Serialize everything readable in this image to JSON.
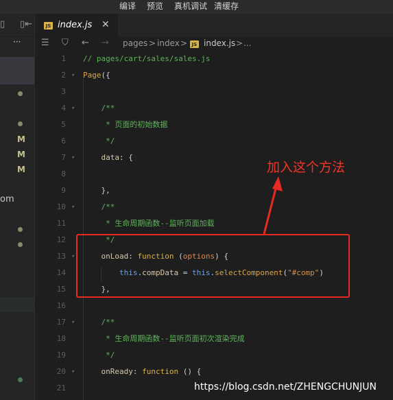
{
  "topbar": {
    "menu": [
      "编译",
      "预览",
      "真机调试",
      "清缓存"
    ]
  },
  "sidebar": {
    "partial_text": "om",
    "git_marks": [
      "M",
      "M",
      "M"
    ],
    "header_icons": [
      "collapse-icon",
      "more-icon"
    ],
    "more_glyph": "···"
  },
  "tab": {
    "label": "index.js",
    "badge": "JS",
    "close_glyph": "✕"
  },
  "breadcrumb": {
    "items": [
      "pages",
      "index",
      "index.js",
      "..."
    ],
    "separator": ">"
  },
  "editor": {
    "lines": [
      {
        "n": "1",
        "fold": "",
        "tokens": [
          [
            "c-comment",
            "// pages/cart/sales/sales.js"
          ]
        ]
      },
      {
        "n": "2",
        "fold": "▾",
        "tokens": [
          [
            "c-func",
            "Page"
          ],
          [
            "c-punct",
            "({"
          ]
        ]
      },
      {
        "n": "3",
        "fold": "",
        "tokens": []
      },
      {
        "n": "4",
        "fold": "▾",
        "tokens": [
          [
            "c-comment",
            "    /**"
          ]
        ]
      },
      {
        "n": "5",
        "fold": "",
        "tokens": [
          [
            "c-comment",
            "     * 页面的初始数据"
          ]
        ]
      },
      {
        "n": "6",
        "fold": "",
        "tokens": [
          [
            "c-comment",
            "     */"
          ]
        ]
      },
      {
        "n": "7",
        "fold": "▾",
        "tokens": [
          [
            "c-ident",
            "    data"
          ],
          [
            "c-punct",
            ": {"
          ]
        ]
      },
      {
        "n": "8",
        "fold": "",
        "tokens": []
      },
      {
        "n": "9",
        "fold": "",
        "tokens": [
          [
            "c-punct",
            "    },"
          ]
        ]
      },
      {
        "n": "10",
        "fold": "▾",
        "tokens": [
          [
            "c-comment",
            "    /**"
          ]
        ]
      },
      {
        "n": "11",
        "fold": "",
        "tokens": [
          [
            "c-comment",
            "     * 生命周期函数--监听页面加载"
          ]
        ]
      },
      {
        "n": "12",
        "fold": "",
        "tokens": [
          [
            "c-comment",
            "     */"
          ]
        ]
      },
      {
        "n": "13",
        "fold": "▾",
        "tokens": [
          [
            "c-ident",
            "    onLoad"
          ],
          [
            "c-punct",
            ": "
          ],
          [
            "c-kw",
            "function"
          ],
          [
            "c-punct",
            " ("
          ],
          [
            "c-param",
            "options"
          ],
          [
            "c-punct",
            ") {"
          ]
        ]
      },
      {
        "n": "14",
        "fold": "",
        "tokens": [
          [
            "c-this",
            "        this"
          ],
          [
            "c-punct",
            "."
          ],
          [
            "c-ident",
            "compData"
          ],
          [
            "c-punct",
            " = "
          ],
          [
            "c-this",
            "this"
          ],
          [
            "c-punct",
            "."
          ],
          [
            "c-func",
            "selectComponent"
          ],
          [
            "c-punct",
            "("
          ],
          [
            "c-str",
            "\"#comp\""
          ],
          [
            "c-punct",
            ")"
          ]
        ]
      },
      {
        "n": "15",
        "fold": "",
        "tokens": [
          [
            "c-punct",
            "    },"
          ]
        ]
      },
      {
        "n": "16",
        "fold": "",
        "tokens": []
      },
      {
        "n": "17",
        "fold": "▾",
        "tokens": [
          [
            "c-comment",
            "    /**"
          ]
        ]
      },
      {
        "n": "18",
        "fold": "",
        "tokens": [
          [
            "c-comment",
            "     * 生命周期函数--监听页面初次渲染完成"
          ]
        ]
      },
      {
        "n": "19",
        "fold": "",
        "tokens": [
          [
            "c-comment",
            "     */"
          ]
        ]
      },
      {
        "n": "20",
        "fold": "▾",
        "tokens": [
          [
            "c-ident",
            "    onReady"
          ],
          [
            "c-punct",
            ": "
          ],
          [
            "c-kw",
            "function"
          ],
          [
            "c-punct",
            " () {"
          ]
        ]
      },
      {
        "n": "21",
        "fold": "",
        "tokens": []
      }
    ]
  },
  "annotation": {
    "text": "加入这个方法",
    "color": "#f23426"
  },
  "watermark": "https://blog.csdn.net/ZHENGCHUNJUN"
}
